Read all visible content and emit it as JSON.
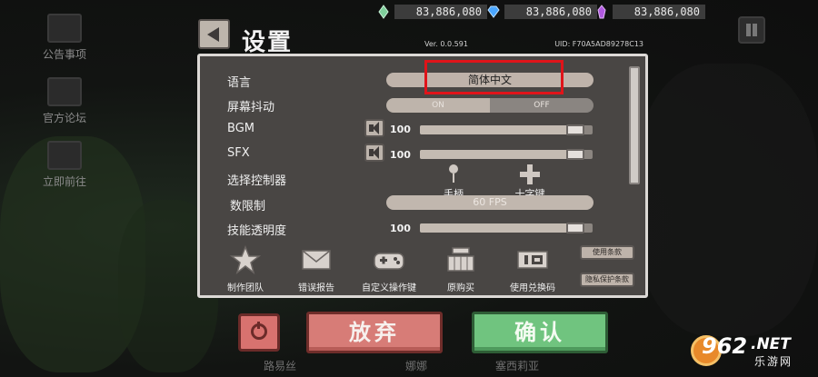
{
  "colors": {
    "panel_bg": "#494644",
    "panel_border": "#dcd9d6",
    "highlight_box": "#e0141a",
    "cancel_button": "#d77c77",
    "confirm_button": "#70c47f"
  },
  "currencies": [
    {
      "icon": "green-crystal-icon",
      "color": "#7fcf9b",
      "value": "83,886,080"
    },
    {
      "icon": "blue-diamond-icon",
      "color": "#4aa6ff",
      "value": "83,886,080"
    },
    {
      "icon": "purple-crystal-icon",
      "color": "#b059e0",
      "value": "83,886,080"
    }
  ],
  "sidebar": {
    "items": [
      {
        "label": "公告事项",
        "icon": "notice-icon"
      },
      {
        "label": "官方论坛",
        "icon": "forum-icon"
      },
      {
        "label": "立即前往",
        "icon": "chat-bubble-icon"
      }
    ]
  },
  "header": {
    "title": "设置",
    "version": "Ver. 0.0.591",
    "uid": "UID: F70A5AD89278C13"
  },
  "settings": {
    "language": {
      "label": "语言",
      "value": "简体中文"
    },
    "shake": {
      "label": "屏幕抖动",
      "on": "ON",
      "off": "OFF",
      "state": "on"
    },
    "bgm": {
      "label": "BGM",
      "value": "100",
      "level": 0.9
    },
    "sfx": {
      "label": "SFX",
      "value": "100",
      "level": 0.9
    },
    "controller": {
      "label": "选择控制器",
      "option1": "手柄",
      "option2": "十字键"
    },
    "fps": {
      "label": "数限制",
      "value": "60 FPS"
    },
    "skill_opacity": {
      "label": "技能透明度",
      "value": "100",
      "level": 0.9
    }
  },
  "bottom_buttons": [
    {
      "label": "制作团队",
      "icon": "team-icon"
    },
    {
      "label": "错误报告",
      "icon": "mail-icon"
    },
    {
      "label": "自定义操作键",
      "icon": "gamepad-icon"
    },
    {
      "label": "原购买",
      "icon": "shop-icon"
    },
    {
      "label": "使用兑换码",
      "icon": "redeem-code-icon"
    }
  ],
  "small_buttons": {
    "terms": "使用条款",
    "privacy": "隐私保护条款"
  },
  "actions": {
    "cancel": "放弃",
    "confirm": "确认"
  },
  "background_names": [
    "路易丝",
    "娜娜",
    "塞西莉亚"
  ],
  "watermark": {
    "number": "962",
    "domain": ".NET",
    "site": "乐游网"
  }
}
